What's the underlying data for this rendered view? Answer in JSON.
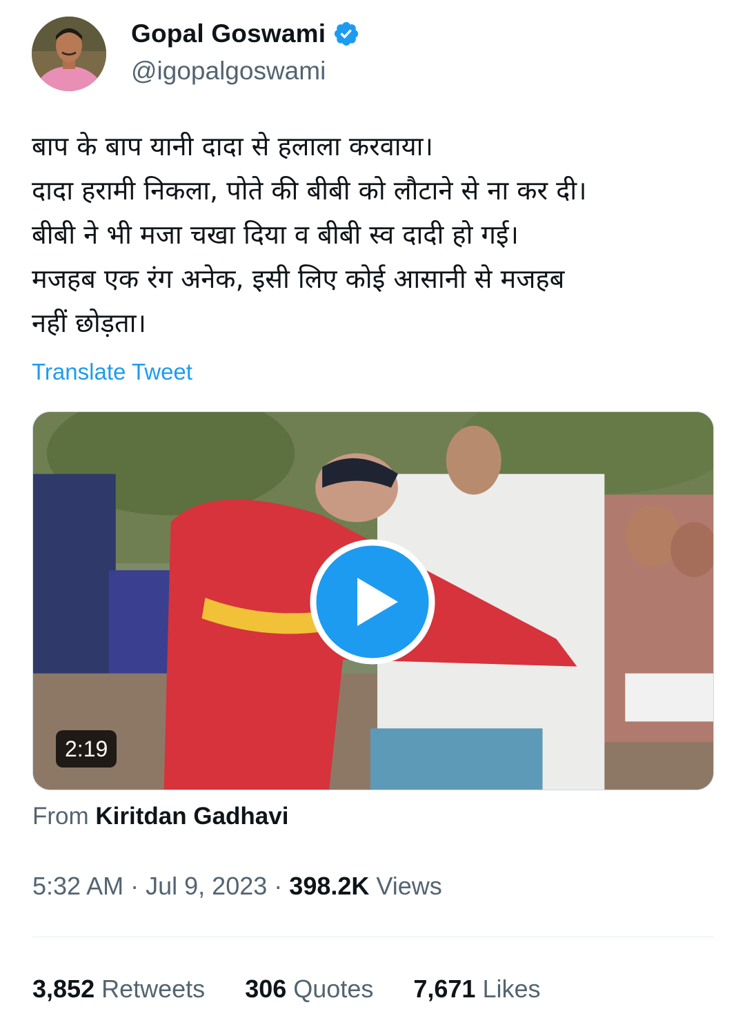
{
  "author": {
    "display_name": "Gopal Goswami",
    "handle": "@igopalgoswami",
    "verified_icon": "verified-badge-icon",
    "avatar_icon": "profile-photo"
  },
  "tweet": {
    "text": "बाप के बाप यानी दादा से हलाला करवाया।\nदादा हरामी निकला, पोते की बीबी को लौटाने से ना कर दी।\nबीबी ने भी मजा चखा दिया व बीबी स्व दादी हो गई।\nमजहब एक रंग अनेक, इसी लिए कोई आसानी से मजहब\nनहीं छोड़ता।",
    "translate_label": "Translate Tweet"
  },
  "media": {
    "type": "video",
    "duration": "2:19",
    "play_icon": "play-icon",
    "source_prefix": "From",
    "source_name": "Kiritdan Gadhavi"
  },
  "meta": {
    "time": "5:32 AM",
    "separator": "·",
    "date": "Jul 9, 2023",
    "views_count": "398.2K",
    "views_label": "Views"
  },
  "stats": {
    "retweets_count": "3,852",
    "retweets_label": "Retweets",
    "quotes_count": "306",
    "quotes_label": "Quotes",
    "likes_count": "7,671",
    "likes_label": "Likes"
  },
  "colors": {
    "accent": "#1d9bf0",
    "text_primary": "#0f1419",
    "text_secondary": "#536471"
  }
}
